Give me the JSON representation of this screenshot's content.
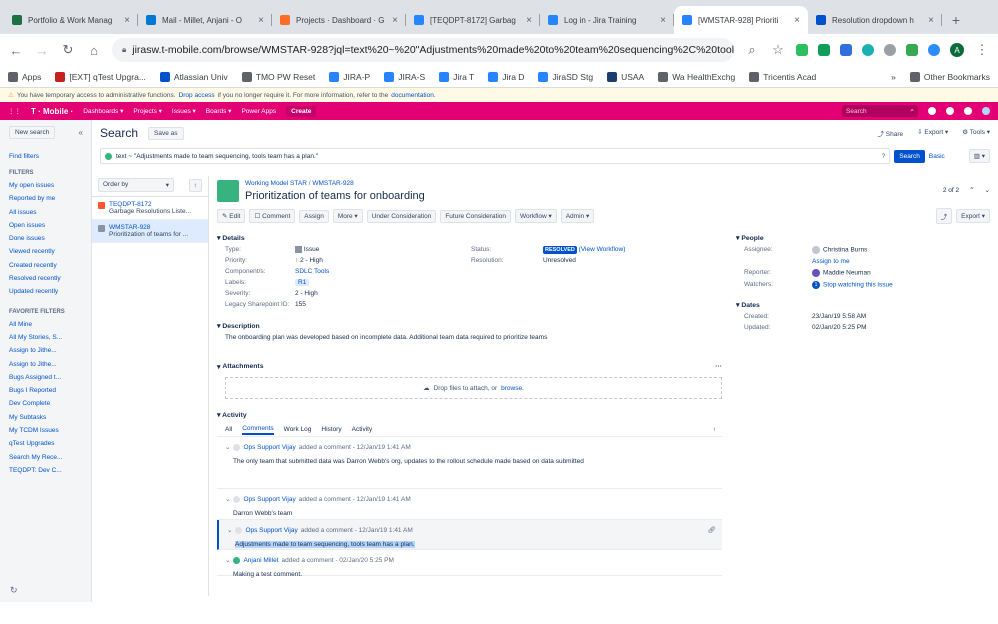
{
  "browser": {
    "tabs": [
      {
        "title": "Portfolio & Work Manag",
        "color": "#1e7145",
        "active": false
      },
      {
        "title": "Mail - Millet, Anjani - O",
        "color": "#0078d4",
        "active": false
      },
      {
        "title": "Projects · Dashboard · G",
        "color": "#fc6d26",
        "active": false
      },
      {
        "title": "[TEQDPT-8172] Garbag",
        "color": "#2684ff",
        "active": false
      },
      {
        "title": "Log in - Jira Training",
        "color": "#2684ff",
        "active": false
      },
      {
        "title": "[WMSTAR-928] Prioriti",
        "color": "#2684ff",
        "active": true
      },
      {
        "title": "Resolution dropdown h",
        "color": "#0052cc",
        "active": false
      }
    ],
    "url": "jirasw.t-mobile.com/browse/WMSTAR-928?jql=text%20~%20\"Adjustments%20made%20to%20team%20sequencing%2C%20tools%20team%2...",
    "bookmarks": [
      "Apps",
      "[EXT] qTest Upgra...",
      "Atlassian Univ",
      "TMO PW Reset",
      "JIRA-P",
      "JIRA-S",
      "Jira T",
      "Jira D",
      "JiraSD Stg",
      "USAA",
      "Wa HealthExchg",
      "Tricentis Acad"
    ],
    "other_bookmarks": "Other Bookmarks",
    "profile_initial": "A"
  },
  "notice": {
    "text": "You have temporary access to administrative functions.",
    "link1": "Drop access",
    "mid": "if you no longer require it. For more information, refer to the",
    "link2": "documentation."
  },
  "topnav": {
    "logo": "T · Mobile ·",
    "items": [
      "Dashboards ▾",
      "Projects ▾",
      "Issues ▾",
      "Boards ▾",
      "Power Apps"
    ],
    "create": "Create",
    "search_placeholder": "Search"
  },
  "sidebar": {
    "new_search": "New search",
    "find_filters": "Find filters",
    "filters_heading": "FILTERS",
    "filters": [
      "My open issues",
      "Reported by me",
      "All issues",
      "Open issues",
      "Done issues",
      "Viewed recently",
      "Created recently",
      "Resolved recently",
      "Updated recently"
    ],
    "favorite_heading": "FAVORITE FILTERS",
    "favorites": [
      "All Mine",
      "All My Stories, S...",
      "Assign to Jithe...",
      "Assign to Jithe...",
      "Bugs Assigned t...",
      "Bugs I Reported",
      "Dev Complete",
      "My Subtasks",
      "My TCDM Issues",
      "qTest Upgrades",
      "Search My Rece...",
      "TEQDPT: Dev C..."
    ]
  },
  "search": {
    "title": "Search",
    "save_as": "Save as",
    "share": "Share",
    "export": "Export ▾",
    "tools": "Tools ▾",
    "query": "text ~ \"Adjustments made to team sequencing, tools team has a plan.\"",
    "search_btn": "Search",
    "basic": "Basic",
    "order_by": "Order by"
  },
  "results": [
    {
      "key": "TEQDPT-8172",
      "summary": "Garbage Resolutions Liste...",
      "color": "#ff5630",
      "selected": false
    },
    {
      "key": "WMSTAR-928",
      "summary": "Prioritization of teams for ...",
      "color": "#8993a4",
      "selected": true
    }
  ],
  "issue": {
    "project": "Working Model STAR",
    "key": "WMSTAR-928",
    "summary": "Prioritization of teams for onboarding",
    "pager": "2 of 2",
    "toolbar": [
      "Edit",
      "Comment",
      "Assign",
      "More ▾",
      "Under Consideration",
      "Future Consideration",
      "Workflow ▾",
      "Admin ▾"
    ],
    "export": "Export ▾",
    "details_heading": "Details",
    "type_label": "Type:",
    "type": "Issue",
    "priority_label": "Priority:",
    "priority": "2 - High",
    "components_label": "Component/s:",
    "components": "SDLC Tools",
    "labels_label": "Labels:",
    "labels": "R1",
    "severity_label": "Severity:",
    "severity": "2 - High",
    "legacy_label": "Legacy Sharepoint ID:",
    "legacy": "155",
    "status_label": "Status:",
    "status": "RESOLVED",
    "view_workflow": "(View Workflow)",
    "resolution_label": "Resolution:",
    "resolution": "Unresolved",
    "description_heading": "Description",
    "description": "The onboarding plan was developed based on incomplete data. Additional team data required to prioritize teams",
    "attachments_heading": "Attachments",
    "drop_text": "Drop files to attach, or",
    "browse": "browse.",
    "activity_heading": "Activity",
    "activity_tabs": [
      "All",
      "Comments",
      "Work Log",
      "History",
      "Activity"
    ]
  },
  "comments": [
    {
      "author": "Ops Support Vijay",
      "meta": "added a comment - 12/Jan/19 1:41 AM",
      "body": "The only team that submitted data was Darron Webb's org, updates to the rollout schedule made based on data submitted",
      "highlight": false
    },
    {
      "author": "Ops Support Vijay",
      "meta": "added a comment - 12/Jan/19 1:41 AM",
      "body": "Darron Webb's team",
      "highlight": false
    },
    {
      "author": "Ops Support Vijay",
      "meta": "added a comment - 12/Jan/19 1:41 AM",
      "body": "Adjustments made to team sequencing, tools team has a plan.",
      "highlight": true
    },
    {
      "author": "Anjani Millet",
      "meta": "added a comment - 02/Jan/20 5:25 PM",
      "body": "Making a test comment.",
      "highlight": false
    }
  ],
  "people": {
    "heading": "People",
    "assignee_label": "Assignee:",
    "assignee": "Christina Burns",
    "assign_me": "Assign to me",
    "reporter_label": "Reporter:",
    "reporter": "Maddie Neuman",
    "watchers_label": "Watchers:",
    "watchers_count": "1",
    "watchers_link": "Stop watching this issue"
  },
  "dates": {
    "heading": "Dates",
    "created_label": "Created:",
    "created": "23/Jan/19 5:58 AM",
    "updated_label": "Updated:",
    "updated": "02/Jan/20 5:25 PM"
  }
}
